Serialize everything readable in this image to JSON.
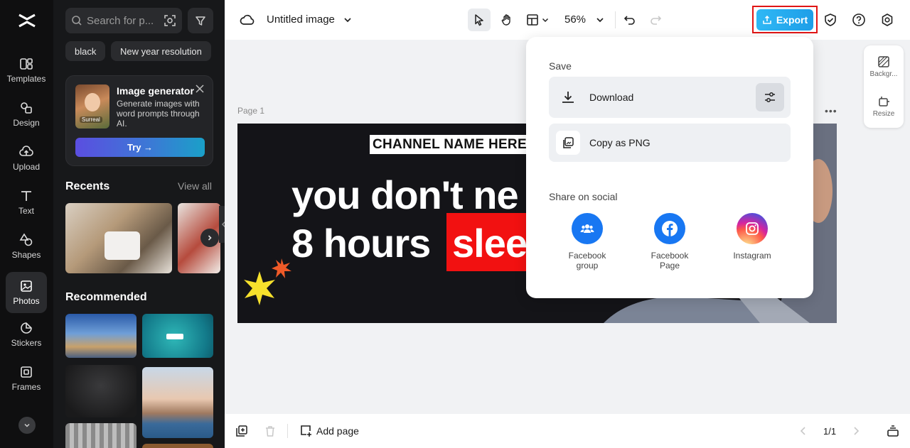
{
  "nav": {
    "items": [
      {
        "label": "Templates",
        "icon": "templates-icon"
      },
      {
        "label": "Design",
        "icon": "design-icon"
      },
      {
        "label": "Upload",
        "icon": "upload-icon"
      },
      {
        "label": "Text",
        "icon": "text-icon"
      },
      {
        "label": "Shapes",
        "icon": "shapes-icon"
      },
      {
        "label": "Photos",
        "icon": "photos-icon"
      },
      {
        "label": "Stickers",
        "icon": "stickers-icon"
      },
      {
        "label": "Frames",
        "icon": "frames-icon"
      }
    ],
    "active": "Photos"
  },
  "panel": {
    "search_placeholder": "Search for p...",
    "chips": [
      "black",
      "New year resolution"
    ],
    "promo": {
      "title": "Image generator",
      "description": "Generate images with word prompts through AI.",
      "thumb_badge": "Surreal",
      "button": "Try →"
    },
    "recents_title": "Recents",
    "view_all": "View all",
    "recommended_title": "Recommended"
  },
  "topbar": {
    "doc_title": "Untitled image",
    "zoom": "56%",
    "export_label": "Export"
  },
  "canvas": {
    "page_label": "Page 1",
    "dots": "•••",
    "channel_name": "CHANNEL NAME HERE",
    "headline_line1": "you don't ne",
    "headline_line2": "8 hours",
    "headline_highlight": "slee"
  },
  "mini_panel": {
    "background_label": "Backgr...",
    "resize_label": "Resize"
  },
  "export_menu": {
    "save_label": "Save",
    "download": "Download",
    "copy_png": "Copy as PNG",
    "share_label": "Share on social",
    "social": [
      {
        "name": "Facebook group",
        "color": "#1877f2"
      },
      {
        "name": "Facebook Page",
        "color": "#1877f2"
      },
      {
        "name": "Instagram",
        "color": "#d62976"
      }
    ]
  },
  "bottombar": {
    "add_page": "Add page",
    "page_count": "1/1"
  },
  "colors": {
    "accent": "#1e9ee8",
    "highlight_red": "#f21111",
    "export_outline": "#e01515"
  }
}
